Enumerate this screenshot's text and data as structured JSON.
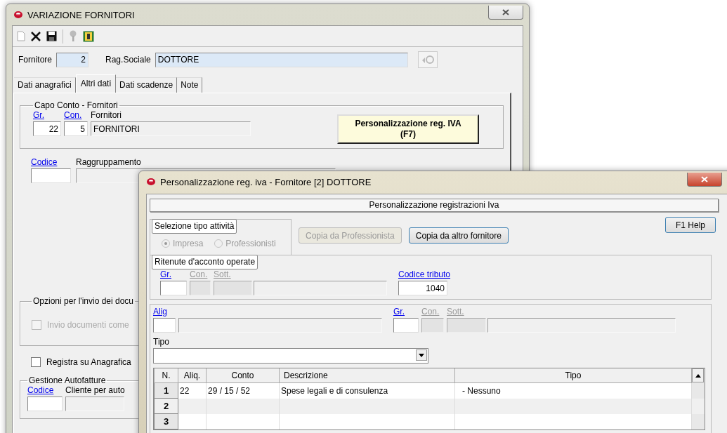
{
  "main_window": {
    "title": "VARIAZIONE FORNITORI",
    "fornitore": {
      "label": "Fornitore",
      "value": "2"
    },
    "rag_sociale": {
      "label": "Rag.Sociale",
      "value": "DOTTORE"
    },
    "tabs": [
      {
        "label": "Dati anagrafici",
        "selected": false
      },
      {
        "label": "Altri dati",
        "selected": true
      },
      {
        "label": "Dati scadenze",
        "selected": false
      },
      {
        "label": "Note",
        "selected": false
      }
    ],
    "capo_conto": {
      "title": "Capo Conto - Fornitori",
      "gr_label": "Gr.",
      "con_label": "Con.",
      "name_label": "Fornitori",
      "gr_value": "22",
      "con_value": "5",
      "name_value": "FORNITORI"
    },
    "iva_button": {
      "lines": [
        "Personalizzazione reg. IVA",
        "(F7)"
      ]
    },
    "codice_label": "Codice",
    "raggruppamento_label": "Raggruppamento",
    "opzioni": {
      "title": "Opzioni per l'invio dei docu",
      "checkbox": {
        "label": "Invio documenti come",
        "checked": false,
        "disabled": true
      }
    },
    "registra": {
      "label": "Registra su Anagrafica",
      "checked": false,
      "disabled": false
    },
    "autofatture": {
      "title": "Gestione Autofatture",
      "codice_label": "Codice",
      "cliente_label": "Cliente per auto"
    }
  },
  "dialog": {
    "title": "Personalizzazione reg. iva - Fornitore [2] DOTTORE",
    "header": "Personalizzazione registrazioni Iva",
    "selezione": {
      "title": "Selezione tipo attività",
      "radios": [
        {
          "label": "Impresa",
          "selected": true,
          "disabled": true
        },
        {
          "label": "Professionisti",
          "selected": false,
          "disabled": true
        }
      ]
    },
    "buttons": [
      {
        "label": "Copia da Professionista",
        "disabled": true
      },
      {
        "label": "Copia da altro fornitore",
        "disabled": false
      }
    ],
    "help_button": "F1 Help",
    "ritenute": {
      "title": "Ritenute d'acconto operate",
      "labels": [
        {
          "text": "Gr.",
          "kind": "link"
        },
        {
          "text": "Con.",
          "kind": "disabled"
        },
        {
          "text": "Sott.",
          "kind": "disabled"
        }
      ],
      "tributo_label": "Codice tributo",
      "tributo_value": "1040"
    },
    "aliquote": {
      "alig_label": "Alig",
      "labels": [
        {
          "text": "Gr.",
          "kind": "link"
        },
        {
          "text": "Con.",
          "kind": "disabled"
        },
        {
          "text": "Sott.",
          "kind": "disabled"
        }
      ],
      "tipo_label": "Tipo"
    },
    "table": {
      "columns": [
        "N.",
        "Aliq.",
        "Conto",
        "Descrizione",
        "Tipo"
      ],
      "rows": [
        {
          "cells": [
            "1",
            "22",
            "29 / 15 / 52",
            "Spese legali e di consulenza",
            "- Nessuno"
          ]
        },
        {
          "cells": [
            "2"
          ]
        },
        {
          "cells": [
            "3"
          ]
        }
      ]
    }
  }
}
